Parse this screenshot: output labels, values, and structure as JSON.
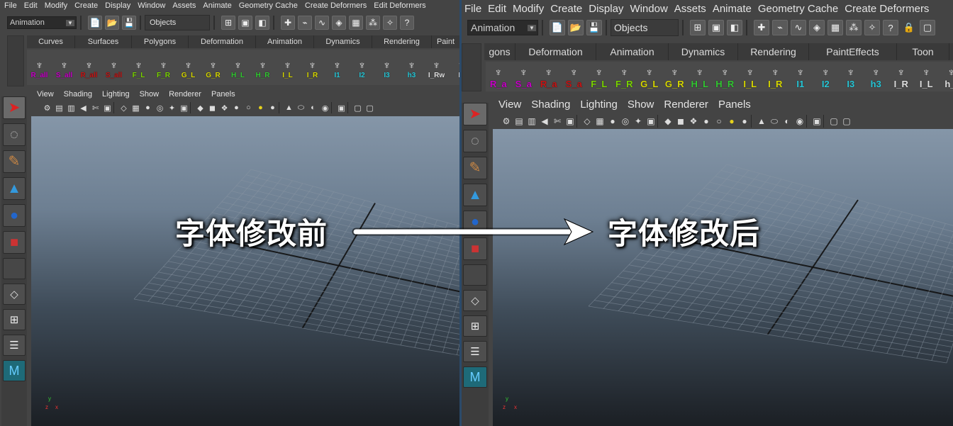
{
  "menu": [
    "File",
    "Edit",
    "Modify",
    "Create",
    "Display",
    "Window",
    "Assets",
    "Animate",
    "Geometry Cache",
    "Create Deformers",
    "Edit Deformers"
  ],
  "menu_right": [
    "File",
    "Edit",
    "Modify",
    "Create",
    "Display",
    "Window",
    "Assets",
    "Animate",
    "Geometry Cache",
    "Create Deformers"
  ],
  "status": {
    "mode": "Animation",
    "selection": "Objects"
  },
  "shelf_tabs_left": [
    "Curves",
    "Surfaces",
    "Polygons",
    "Deformation",
    "Animation",
    "Dynamics",
    "Rendering",
    "Paint"
  ],
  "shelf_tabs_right": [
    "gons",
    "Deformation",
    "Animation",
    "Dynamics",
    "Rendering",
    "PaintEffects",
    "Toon"
  ],
  "shelf_left": [
    {
      "label": "R_all",
      "color": "#c800c8"
    },
    {
      "label": "S_all",
      "color": "#c800c8"
    },
    {
      "label": "R_all",
      "color": "#c81414"
    },
    {
      "label": "S_all",
      "color": "#c81414"
    },
    {
      "label": "F_L",
      "color": "#7ad400"
    },
    {
      "label": "F_R",
      "color": "#7ad400"
    },
    {
      "label": "G_L",
      "color": "#d8d800"
    },
    {
      "label": "G_R",
      "color": "#d8d800"
    },
    {
      "label": "H_L",
      "color": "#32c832"
    },
    {
      "label": "H_R",
      "color": "#32c832"
    },
    {
      "label": "I_L",
      "color": "#d8d800"
    },
    {
      "label": "I_R",
      "color": "#d8d800"
    },
    {
      "label": "I1",
      "color": "#28c8d8"
    },
    {
      "label": "I2",
      "color": "#28c8d8"
    },
    {
      "label": "I3",
      "color": "#28c8d8"
    },
    {
      "label": "h3",
      "color": "#28c8d8"
    },
    {
      "label": "I_Rw",
      "color": "#e0e0e0"
    },
    {
      "label": "I_",
      "color": "#e0e0e0"
    }
  ],
  "shelf_right": [
    {
      "label": "R_a",
      "color": "#c800c8"
    },
    {
      "label": "S_a",
      "color": "#c800c8"
    },
    {
      "label": "R_a",
      "color": "#c81414"
    },
    {
      "label": "S_a",
      "color": "#c81414"
    },
    {
      "label": "F_L",
      "color": "#7ad400"
    },
    {
      "label": "F_R",
      "color": "#7ad400"
    },
    {
      "label": "G_L",
      "color": "#d8d800"
    },
    {
      "label": "G_R",
      "color": "#d8d800"
    },
    {
      "label": "H_L",
      "color": "#32c832"
    },
    {
      "label": "H_R",
      "color": "#32c832"
    },
    {
      "label": "I_L",
      "color": "#d8d800"
    },
    {
      "label": "I_R",
      "color": "#d8d800"
    },
    {
      "label": "I1",
      "color": "#28c8d8"
    },
    {
      "label": "I2",
      "color": "#28c8d8"
    },
    {
      "label": "I3",
      "color": "#28c8d8"
    },
    {
      "label": "h3",
      "color": "#28c8d8"
    },
    {
      "label": "I_R",
      "color": "#e0e0e0"
    },
    {
      "label": "I_L",
      "color": "#e0e0e0"
    },
    {
      "label": "h_l",
      "color": "#e0e0e0"
    }
  ],
  "panel_menu": [
    "View",
    "Shading",
    "Lighting",
    "Show",
    "Renderer",
    "Panels"
  ],
  "overlay": {
    "before": "字体修改前",
    "after": "字体修改后"
  },
  "axis": {
    "x": "x",
    "y": "y",
    "z": "z"
  }
}
